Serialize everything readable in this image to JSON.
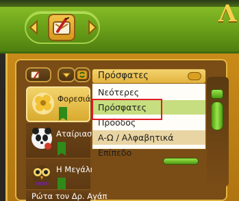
{
  "title_glyph": "Λ",
  "nav": {
    "left_arrow_icon": "chevron-left-icon",
    "right_arrow_icon": "chevron-right-icon",
    "book_icon": "quest-book-icon"
  },
  "filters": {
    "sort_icon": "book-feather-icon",
    "dropdown_icon": "chevron-down-icon",
    "refresh_icon": "refresh-icon"
  },
  "dropdown": {
    "selected": "Πρόσφατες",
    "options": [
      "Νεότερες",
      "Πρόσφατες",
      "Πρόοδος",
      "Α-Ω / Αλφαβητικά",
      "Επίπεδο"
    ],
    "highlighted_index": 1
  },
  "rows": [
    {
      "name": "Φορεσιά",
      "avatar": "flower-icon",
      "badge": "ribbon-icon"
    },
    {
      "name": "Αταίριαστ",
      "avatar": "panda-icon",
      "badge": "ribbon-icon"
    },
    {
      "name": "Η Μεγάλη",
      "avatar": "owl-icon",
      "badge": "ribbon-icon"
    },
    {
      "name": "Ρώτα τον Δρ. Αγάπ",
      "avatar": "",
      "badge": ""
    }
  ],
  "colors": {
    "frame_green": "#6aa11a",
    "panel_gold": "#c98a18",
    "selected_option": "#c6de7f",
    "highlight_red": "#e01b24"
  }
}
